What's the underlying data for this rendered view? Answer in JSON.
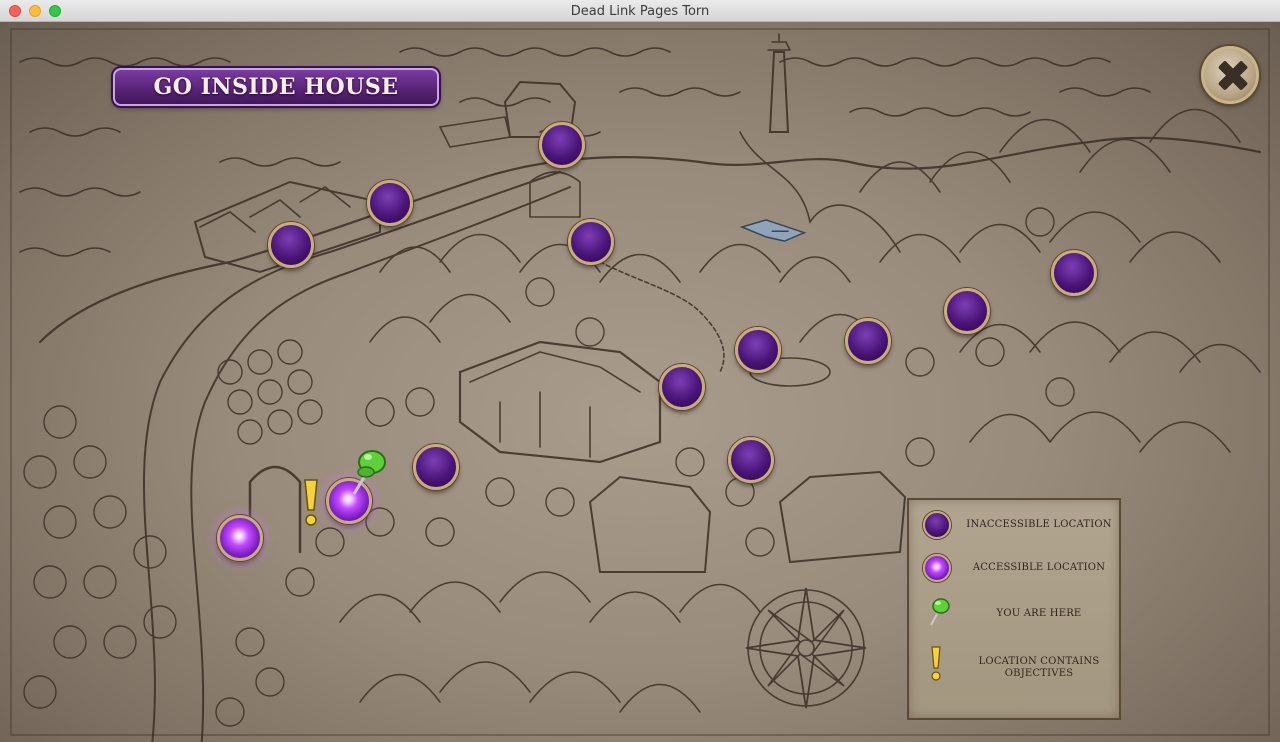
{
  "window": {
    "title": "Dead Link Pages Torn"
  },
  "map": {
    "go_button_label": "GO INSIDE HOUSE",
    "close_icon": "close-x-icon",
    "locations": [
      {
        "name": "dock-house",
        "state": "inaccessible"
      },
      {
        "name": "row-houses-east",
        "state": "inaccessible"
      },
      {
        "name": "row-houses-west",
        "state": "inaccessible"
      },
      {
        "name": "gazebo",
        "state": "inaccessible"
      },
      {
        "name": "east-hills",
        "state": "inaccessible"
      },
      {
        "name": "north-hills",
        "state": "inaccessible"
      },
      {
        "name": "far-east-hills",
        "state": "inaccessible"
      },
      {
        "name": "well",
        "state": "inaccessible"
      },
      {
        "name": "manor",
        "state": "inaccessible"
      },
      {
        "name": "shed",
        "state": "inaccessible"
      },
      {
        "name": "statue-path",
        "state": "inaccessible"
      },
      {
        "name": "current-location",
        "state": "accessible"
      },
      {
        "name": "gate",
        "state": "accessible"
      }
    ]
  },
  "legend": {
    "items": [
      {
        "icon": "inaccessible-location-icon",
        "label": "INACCESSIBLE LOCATION"
      },
      {
        "icon": "accessible-location-icon",
        "label": "ACCESSIBLE LOCATION"
      },
      {
        "icon": "pushpin-icon",
        "label": "YOU ARE HERE"
      },
      {
        "icon": "exclamation-icon",
        "label": "LOCATION CONTAINS OBJECTIVES"
      }
    ]
  },
  "colors": {
    "parchment": "#a99c8c",
    "ink": "#2e2620",
    "button_purple": "#5a2478",
    "orb_purple": "#4a1478",
    "orb_glow": "#c349ff",
    "pin_green": "#5fcf3a",
    "objective_yellow": "#f3d23a"
  }
}
